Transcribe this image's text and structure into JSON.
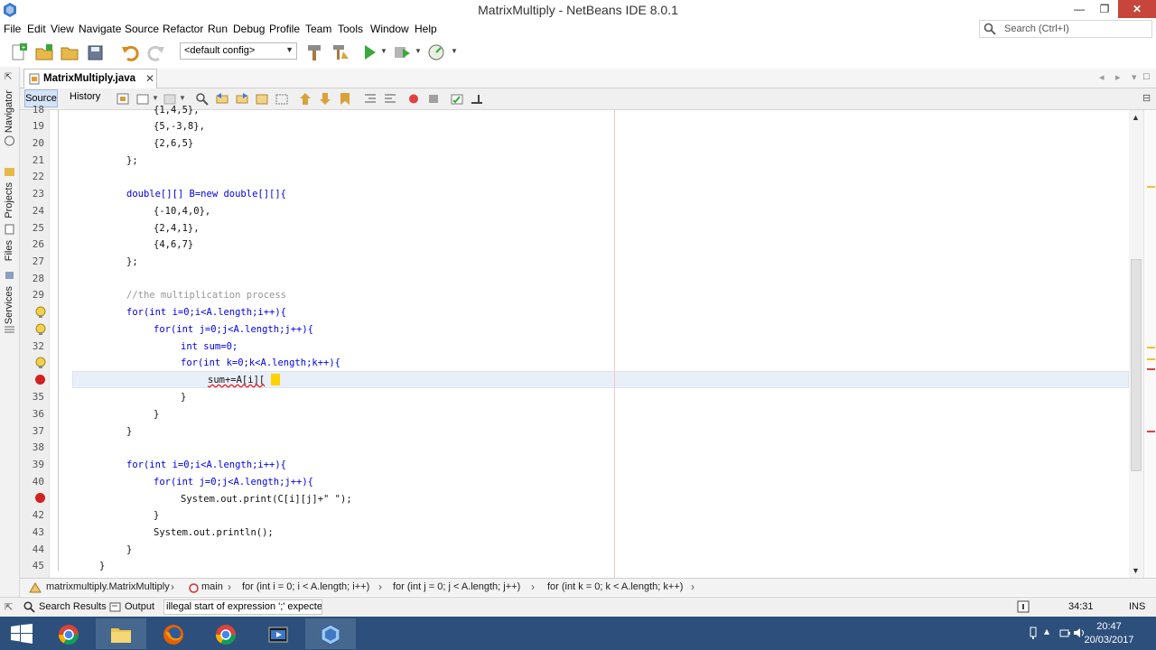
{
  "window": {
    "title": "MatrixMultiply - NetBeans IDE 8.0.1",
    "minimize_glyph": "—",
    "maximize_glyph": "❐",
    "close_glyph": "✕"
  },
  "menu": [
    "File",
    "Edit",
    "View",
    "Navigate",
    "Source",
    "Refactor",
    "Run",
    "Debug",
    "Profile",
    "Team",
    "Tools",
    "Window",
    "Help"
  ],
  "search": {
    "placeholder": "Search (Ctrl+I)"
  },
  "toolbar": {
    "config_value": "<default config>"
  },
  "sidebar": {
    "labels": [
      "Navigator",
      "Projects",
      "Files",
      "Services"
    ]
  },
  "editor_tab": {
    "filename": "MatrixMultiply.java",
    "close_glyph": "✕"
  },
  "editor_toolbar": {
    "source_label": "Source",
    "history_label": "History"
  },
  "code_lines": [
    {
      "n": "18",
      "text": "{1,4,5},"
    },
    {
      "n": "19",
      "text": "{5,-3,8},"
    },
    {
      "n": "20",
      "text": "{2,6,5}"
    },
    {
      "n": "21",
      "text": "};"
    },
    {
      "n": "22",
      "text": ""
    },
    {
      "n": "23",
      "text": "double[][] B=new double[][]{"
    },
    {
      "n": "24",
      "text": "{-10,4,0},"
    },
    {
      "n": "25",
      "text": "{2,4,1},"
    },
    {
      "n": "26",
      "text": "{4,6,7}"
    },
    {
      "n": "27",
      "text": "};"
    },
    {
      "n": "28",
      "text": ""
    },
    {
      "n": "29",
      "text": "//the multiplication process"
    },
    {
      "n": "30",
      "text": "for(int i=0;i<A.length;i++){"
    },
    {
      "n": "31",
      "text": "for(int j=0;j<A.length;j++){"
    },
    {
      "n": "32",
      "text": "int sum=0;"
    },
    {
      "n": "33",
      "text": "for(int k=0;k<A.length;k++){"
    },
    {
      "n": "34",
      "text": "sum+=A[i]["
    },
    {
      "n": "35",
      "text": "}"
    },
    {
      "n": "36",
      "text": "}"
    },
    {
      "n": "37",
      "text": "}"
    },
    {
      "n": "38",
      "text": ""
    },
    {
      "n": "39",
      "text": "for(int i=0;i<A.length;i++){"
    },
    {
      "n": "40",
      "text": "for(int j=0;j<A.length;j++){"
    },
    {
      "n": "41",
      "text": "System.out.print(C[i][j]+\" \");"
    },
    {
      "n": "42",
      "text": "}"
    },
    {
      "n": "43",
      "text": "System.out.println();"
    },
    {
      "n": "44",
      "text": "}"
    },
    {
      "n": "45",
      "text": "}"
    }
  ],
  "breadcrumbs": [
    "matrixmultiply.MatrixMultiply",
    "main",
    "for (int i = 0; i < A.length; i++)",
    "for (int j = 0; j < A.length; j++)",
    "for (int k = 0; k < A.length; k++)"
  ],
  "status": {
    "search_results_label": "Search Results",
    "output_label": "Output",
    "message": "illegal start of expression ';' expected",
    "position": "34:31",
    "mode": "INS"
  },
  "clock": {
    "time": "20:47",
    "date": "20/03/2017"
  },
  "colors": {
    "keyword": "#0000e6",
    "comment": "#969696",
    "field": "#009900",
    "error": "#d32020",
    "taskbar": "#2c4f7c"
  }
}
